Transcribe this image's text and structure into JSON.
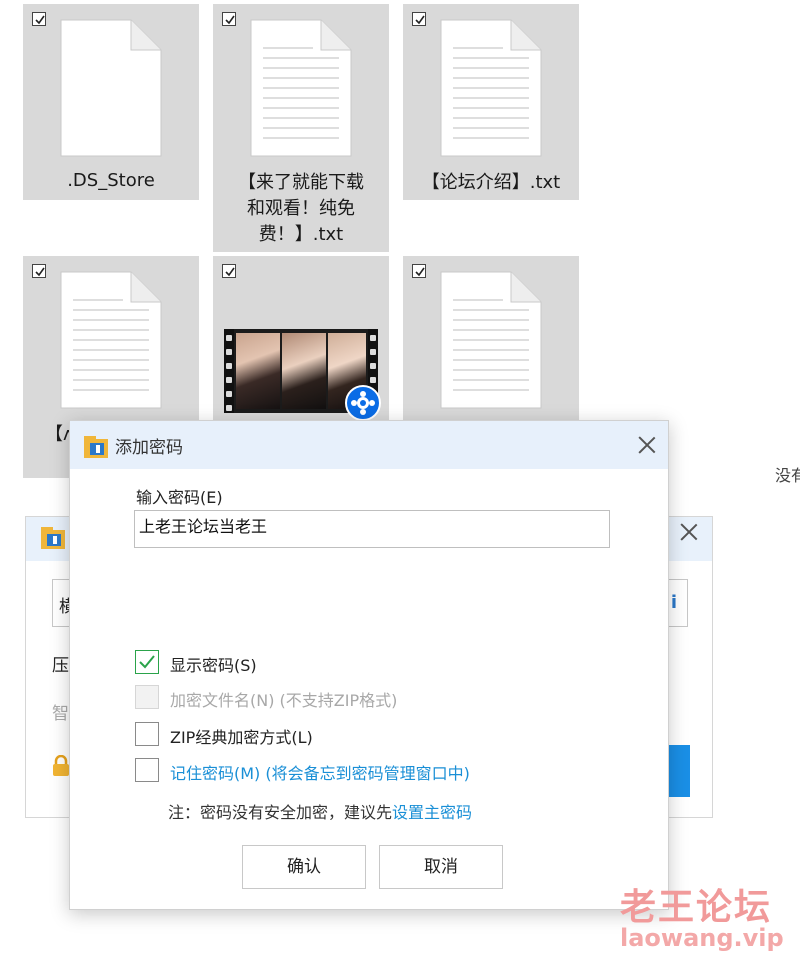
{
  "files": [
    {
      "name": ".DS_Store",
      "type": "document"
    },
    {
      "name": "【来了就能下载和观看！纯免费！】.txt",
      "type": "text-document"
    },
    {
      "name": "【论坛介绍】.txt",
      "type": "text-document"
    },
    {
      "name": "【ᴧ",
      "type": "text-document"
    },
    {
      "name": "",
      "type": "video"
    },
    {
      "name": "",
      "type": "text-document"
    }
  ],
  "side_text": "没有",
  "bg_dialog": {
    "field_fragment": "横",
    "line1": "压",
    "line2": "智"
  },
  "dialog": {
    "title": "添加密码",
    "password_label": "输入密码(E)",
    "password_value": "上老王论坛当老王",
    "options": [
      {
        "label": "显示密码(S)",
        "checked": true,
        "disabled": false
      },
      {
        "label": "加密文件名(N) (不支持ZIP格式)",
        "checked": false,
        "disabled": true
      },
      {
        "label": "ZIP经典加密方式(L)",
        "checked": false,
        "disabled": false
      },
      {
        "label": "记住密码(M) (将会备忘到密码管理窗口中)",
        "checked": false,
        "disabled": false
      }
    ],
    "note_prefix": "注：密码没有安全加密，建议先",
    "note_link": "设置主密码",
    "ok_label": "确认",
    "cancel_label": "取消"
  },
  "watermark": {
    "cn": "老王论坛",
    "url": "laowang.vip"
  },
  "colors": {
    "checked": "#2aa34a",
    "link": "#1a8fd6",
    "titlebar": "#e7f0fb",
    "tile": "#d9d9d9"
  }
}
